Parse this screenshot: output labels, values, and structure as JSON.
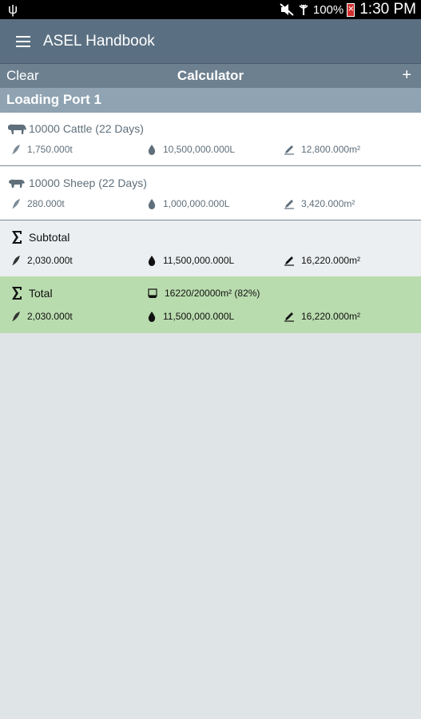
{
  "status_bar": {
    "usb_icon": "usb-icon",
    "battery_percent": "100%",
    "time": "1:30 PM"
  },
  "app_bar": {
    "title": "ASEL Handbook"
  },
  "calculator_bar": {
    "clear_label": "Clear",
    "title": "Calculator",
    "add_label": "+"
  },
  "section": {
    "title": "Loading Port 1"
  },
  "items": [
    {
      "name": "10000 Cattle (22 Days)",
      "icon": "cattle-icon",
      "weight": "1,750.000t",
      "water": "10,500,000.000L",
      "area": "12,800.000m²"
    },
    {
      "name": "10000 Sheep (22 Days)",
      "icon": "sheep-icon",
      "weight": "280.000t",
      "water": "1,000,000.000L",
      "area": "3,420.000m²"
    }
  ],
  "subtotal": {
    "label": "Subtotal",
    "weight": "2,030.000t",
    "water": "11,500,000.000L",
    "area": "16,220.000m²"
  },
  "total": {
    "label": "Total",
    "capacity": "16220/20000m² (82%)",
    "capacity_fraction": 0.82,
    "weight": "2,030.000t",
    "water": "11,500,000.000L",
    "area": "16,220.000m²"
  },
  "colors": {
    "app_bar": "#5a7082",
    "section": "#8fa3b2",
    "total_row": "#b9dcae",
    "background": "#dfe4e7"
  }
}
